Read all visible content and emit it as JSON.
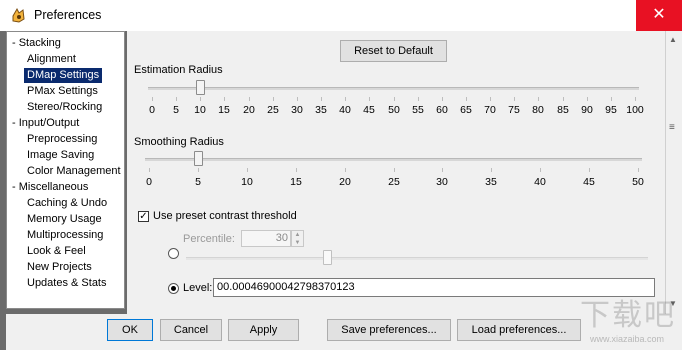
{
  "window": {
    "title": "Preferences",
    "close_glyph": "✕"
  },
  "tree": [
    {
      "label": "- Stacking",
      "indent": 0,
      "selected": false
    },
    {
      "label": "Alignment",
      "indent": 1,
      "selected": false
    },
    {
      "label": "DMap Settings",
      "indent": 1,
      "selected": true
    },
    {
      "label": "PMax Settings",
      "indent": 1,
      "selected": false
    },
    {
      "label": "Stereo/Rocking",
      "indent": 1,
      "selected": false
    },
    {
      "label": "- Input/Output",
      "indent": 0,
      "selected": false
    },
    {
      "label": "Preprocessing",
      "indent": 1,
      "selected": false
    },
    {
      "label": "Image Saving",
      "indent": 1,
      "selected": false
    },
    {
      "label": "Color Management",
      "indent": 1,
      "selected": false
    },
    {
      "label": "- Miscellaneous",
      "indent": 0,
      "selected": false
    },
    {
      "label": "Caching & Undo",
      "indent": 1,
      "selected": false
    },
    {
      "label": "Memory Usage",
      "indent": 1,
      "selected": false
    },
    {
      "label": "Multiprocessing",
      "indent": 1,
      "selected": false
    },
    {
      "label": "Look & Feel",
      "indent": 1,
      "selected": false
    },
    {
      "label": "New Projects",
      "indent": 1,
      "selected": false
    },
    {
      "label": "Updates & Stats",
      "indent": 1,
      "selected": false
    }
  ],
  "panel": {
    "reset_label": "Reset to Default",
    "estimation": {
      "label": "Estimation Radius",
      "value": 10,
      "ticks": [
        "0",
        "5",
        "10",
        "15",
        "20",
        "25",
        "30",
        "35",
        "40",
        "45",
        "50",
        "55",
        "60",
        "65",
        "70",
        "75",
        "80",
        "85",
        "90",
        "95",
        "100"
      ]
    },
    "smoothing": {
      "label": "Smoothing Radius",
      "value": 5,
      "ticks": [
        "0",
        "5",
        "10",
        "15",
        "20",
        "25",
        "30",
        "35",
        "40",
        "45",
        "50"
      ]
    },
    "contrast": {
      "checkbox_label": "Use preset contrast threshold",
      "checked": true,
      "percentile_label": "Percentile:",
      "percentile_value": "30",
      "level_label": "Level:",
      "level_value": "00.00046900042798370123"
    }
  },
  "footer": {
    "ok": "OK",
    "cancel": "Cancel",
    "apply": "Apply",
    "save": "Save preferences...",
    "load": "Load preferences..."
  },
  "watermark": {
    "main": "下载吧",
    "sub": "www.xiazaiba.com"
  },
  "colors": {
    "close": "#e81123",
    "selection": "#0a2a6e",
    "frame": "#6b6b6b"
  }
}
